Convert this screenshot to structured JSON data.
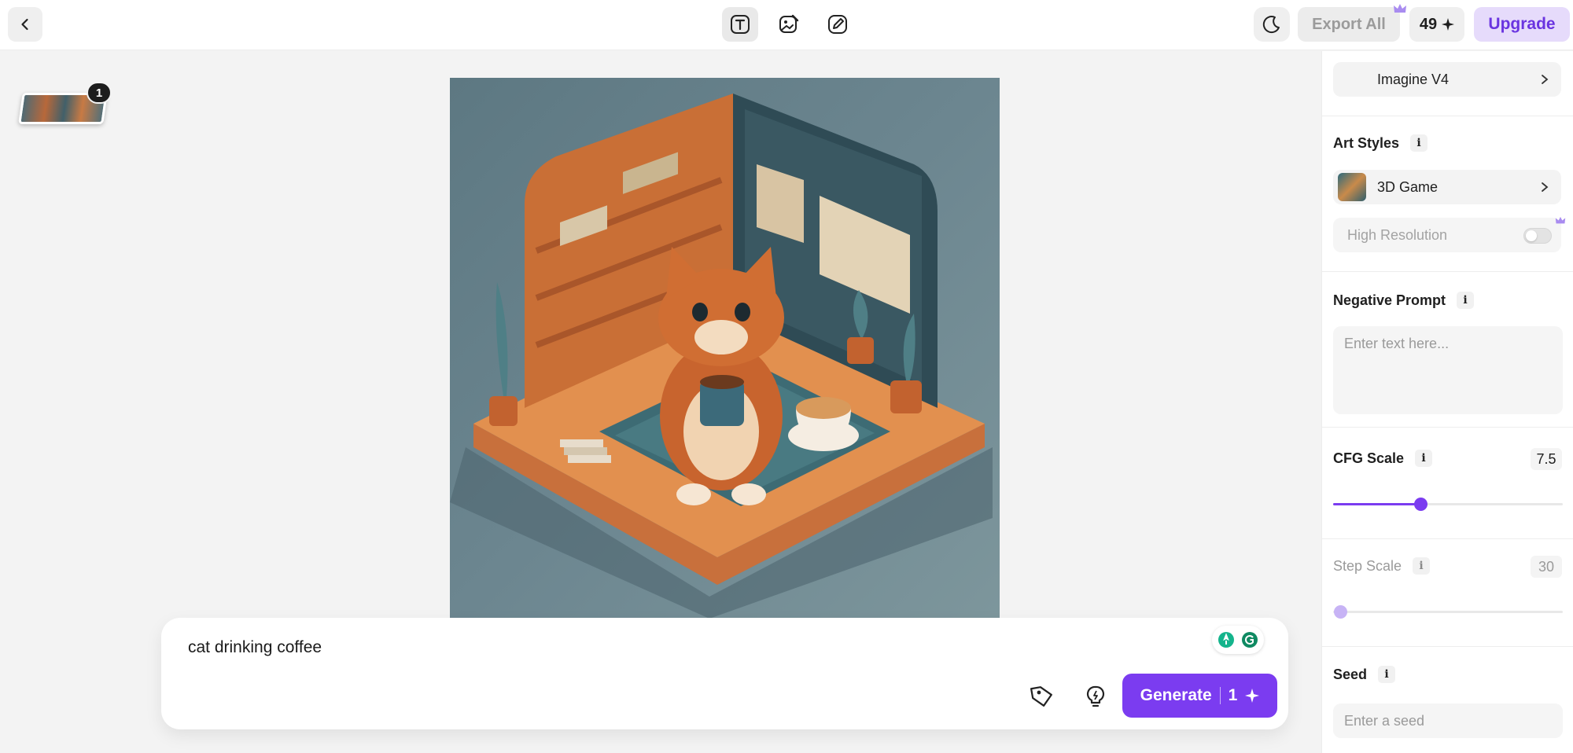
{
  "header": {
    "export_label": "Export All",
    "credits": "49",
    "upgrade_label": "Upgrade"
  },
  "history": {
    "count": "1"
  },
  "prompt": {
    "text": "cat drinking coffee",
    "generate_label": "Generate",
    "generate_cost": "1"
  },
  "settings": {
    "model": "Imagine V4",
    "art_styles_title": "Art Styles",
    "art_style": "3D Game",
    "high_resolution_label": "High Resolution",
    "high_resolution_enabled": false,
    "negative_prompt_title": "Negative Prompt",
    "negative_prompt_placeholder": "Enter text here...",
    "cfg_scale_title": "CFG Scale",
    "cfg_scale_value": "7.5",
    "cfg_scale_fraction": 0.38,
    "step_scale_title": "Step Scale",
    "step_scale_value": "30",
    "step_scale_fraction": 0.03,
    "seed_title": "Seed",
    "seed_placeholder": "Enter a seed"
  },
  "colors": {
    "accent": "#7b3cf0",
    "upgrade_bg": "#e6dbfb"
  }
}
